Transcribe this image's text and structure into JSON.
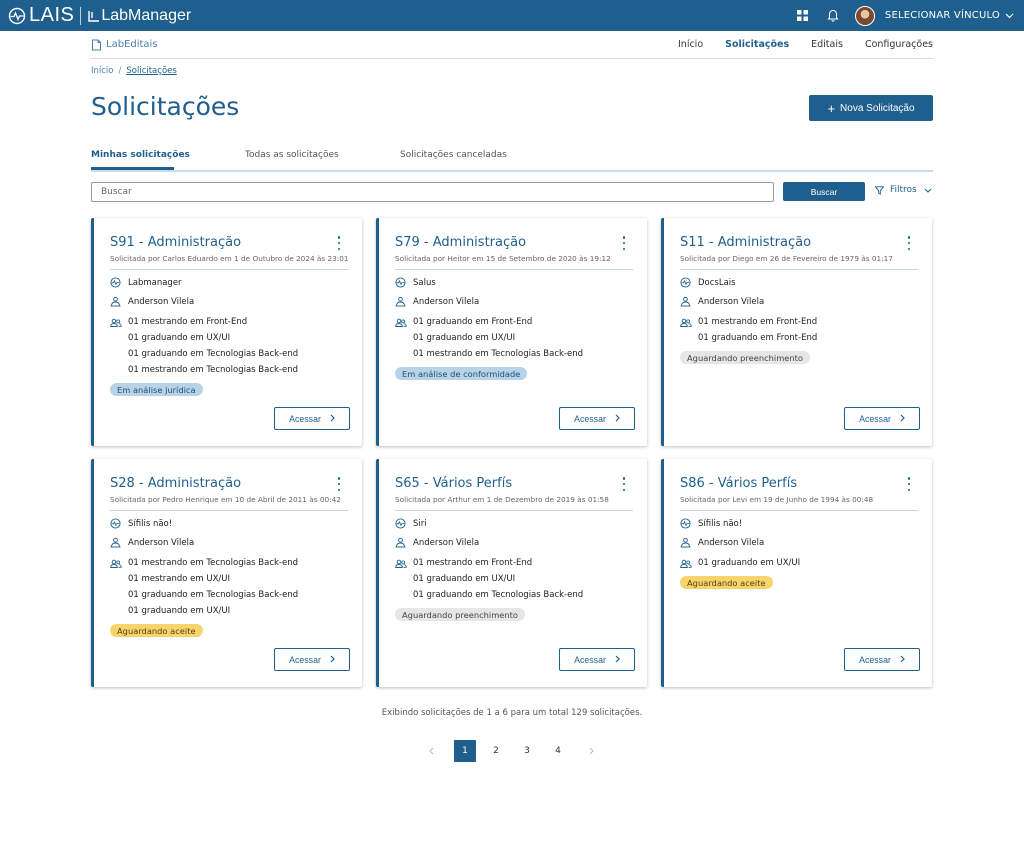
{
  "topbar": {
    "logo_text": "LAIS",
    "product": "LabManager",
    "vinculo_label": "SELECIONAR VÍNCULO",
    "icons": [
      "grid-icon",
      "bell-icon",
      "avatar",
      "chevron-down-icon"
    ]
  },
  "subnav": {
    "brand": "LabEditais",
    "links": [
      {
        "label": "Início"
      },
      {
        "label": "Solicitações"
      },
      {
        "label": "Editais"
      },
      {
        "label": "Configurações"
      }
    ]
  },
  "breadcrumb": {
    "home": "Início",
    "sep": "/",
    "current": "Solicitações"
  },
  "page": {
    "title": "Solicitações",
    "new_button": "Nova Solicitação"
  },
  "tabs": [
    {
      "label": "Minhas solicitações"
    },
    {
      "label": "Todas as solicitações"
    },
    {
      "label": "Solicitações canceladas"
    }
  ],
  "search": {
    "placeholder": "Buscar",
    "button": "Buscar",
    "filters": "Filtros"
  },
  "access_label": "Acessar",
  "cards": [
    {
      "id": "S91 - Administração",
      "subtitle": "Solicitada por Carlos Eduardo em 1 de Outubro de 2024 às 23:01",
      "system": "Labmanager",
      "person": "Anderson Vilela",
      "profiles": [
        "01 mestrando em Front-End",
        "01 graduando em UX/UI",
        "01 graduando em Tecnologias Back-end",
        "01 mestrando em Tecnologias Back-end"
      ],
      "status": "Em análise jurídica",
      "status_color": "#b8d3e8"
    },
    {
      "id": "S79 - Administração",
      "subtitle": "Solicitada por Heitor em 15 de Setembro de 2020 às 19:12",
      "system": "Salus",
      "person": "Anderson Vilela",
      "profiles": [
        "01 graduando em Front-End",
        "01 graduando em UX/UI",
        "01 mestrando em Tecnologias Back-end"
      ],
      "status": "Em análise de conformidade",
      "status_color": "#b8d3e8"
    },
    {
      "id": "S11 - Administração",
      "subtitle": "Solicitada por Diego em 26 de Fevereiro de 1979 às 01:17",
      "system": "DocsLais",
      "person": "Anderson Vilela",
      "profiles": [
        "01 mestrando em Front-End",
        "01 graduando em Front-End"
      ],
      "status": "Aguardando preenchimento",
      "status_color": "#e6e6e6"
    },
    {
      "id": "S28 - Administração",
      "subtitle": "Solicitada por Pedro Henrique em 10 de Abril de 2011 às 00:42",
      "system": "Sífilis não!",
      "person": "Anderson Vilela",
      "profiles": [
        "01 mestrando em Tecnologias Back-end",
        "01 mestrando em UX/UI",
        "01 graduando em Tecnologias Back-end",
        "01 graduando em UX/UI"
      ],
      "status": "Aguardando aceite",
      "status_color": "#f7d46d"
    },
    {
      "id": "S65 - Vários Perfís",
      "subtitle": "Solicitada por Arthur em 1 de Dezembro de 2019 às 01:58",
      "system": "Siri",
      "person": "Anderson Vilela",
      "profiles": [
        "01 mestrando em Front-End",
        "01 graduando em UX/UI",
        "01 graduando em Tecnologias Back-end"
      ],
      "status": "Aguardando preenchimento",
      "status_color": "#e6e6e6"
    },
    {
      "id": "S86 - Vários Perfís",
      "subtitle": "Solicitada por Levi em 19 de Junho de 1994 às 00:48",
      "system": "Sífilis não!",
      "person": "Anderson Vilela",
      "profiles": [
        "01 graduando em UX/UI"
      ],
      "status": "Aguardando aceite",
      "status_color": "#f7d46d"
    }
  ],
  "summary": "Exibindo solicitações de 1 a 6 para um total 129 solicitações.",
  "pagination": {
    "pages": [
      "1",
      "2",
      "3",
      "4"
    ],
    "current": "1"
  }
}
